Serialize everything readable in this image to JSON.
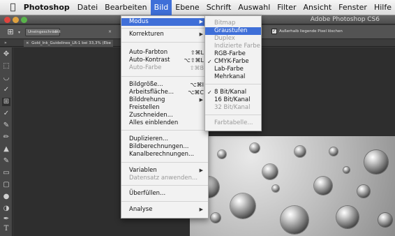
{
  "menubar": {
    "apple": "",
    "items": [
      "Photoshop",
      "Datei",
      "Bearbeiten",
      "Bild",
      "Ebene",
      "Schrift",
      "Auswahl",
      "Filter",
      "Ansicht",
      "Fenster",
      "Hilfe"
    ],
    "active": "Bild"
  },
  "window": {
    "title": "Adobe Photoshop CS6"
  },
  "options_bar": {
    "style_select": "Uneingeschränkt",
    "checkbox_label": "Außerhalb liegende Pixel löschen",
    "checkbox_checked": true
  },
  "document": {
    "tab_title": "Gold_Ink_Guidelines_LR-1 bei 33,3% (Ebe"
  },
  "bild_menu": {
    "modus": "Modus",
    "korrekturen": "Korrekturen",
    "auto_farbton": {
      "label": "Auto-Farbton",
      "shortcut": "⇧⌘L"
    },
    "auto_kontrast": {
      "label": "Auto-Kontrast",
      "shortcut": "⌥⇧⌘L"
    },
    "auto_farbe": {
      "label": "Auto-Farbe",
      "shortcut": "⇧⌘B"
    },
    "bildgroesse": {
      "label": "Bildgröße...",
      "shortcut": "⌥⌘I"
    },
    "arbeitsflaeche": {
      "label": "Arbeitsfläche...",
      "shortcut": "⌥⌘C"
    },
    "bilddrehung": "Bilddrehung",
    "freistellen": "Freistellen",
    "zuschneiden": "Zuschneiden...",
    "alles_einblenden": "Alles einblenden",
    "duplizieren": "Duplizieren...",
    "bildberechnungen": "Bildberechnungen...",
    "kanalberechnungen": "Kanalberechnungen...",
    "variablen": "Variablen",
    "datensatz": "Datensatz anwenden...",
    "ueberfuellen": "Überfüllen...",
    "analyse": "Analyse"
  },
  "modus_submenu": {
    "bitmap": "Bitmap",
    "graustufen": "Graustufen",
    "duplex": "Duplex",
    "indizierte_farbe": "Indizierte Farbe",
    "rgb": "RGB-Farbe",
    "cmyk": "CMYK-Farbe",
    "lab": "Lab-Farbe",
    "mehrkanal": "Mehrkanal",
    "bit8": "8 Bit/Kanal",
    "bit16": "16 Bit/Kanal",
    "bit32": "32 Bit/Kanal",
    "farbtabelle": "Farbtabelle...",
    "checked": [
      "CMYK-Farbe",
      "8 Bit/Kanal"
    ],
    "highlighted": "Graustufen"
  },
  "colors": {
    "highlight": "#3f6fd8",
    "menu_bg": "#f2f2f2",
    "ui_dark": "#3a3a3a"
  }
}
